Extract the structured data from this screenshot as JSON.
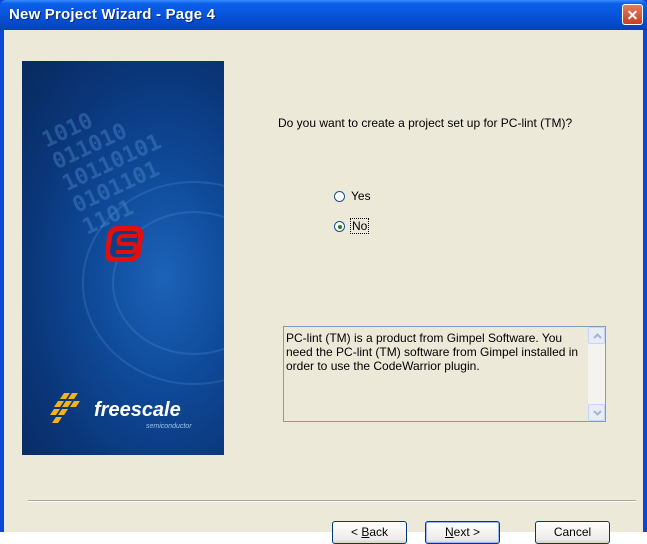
{
  "window": {
    "title": "New Project Wizard - Page  4"
  },
  "side_panel": {
    "brand_name": "freescale",
    "brand_sub": "semiconductor",
    "binary_text": "1010\n011010\n10110101\n0101101\n1101"
  },
  "question": {
    "text": "Do you want to create a project set up for PC-lint (TM)?"
  },
  "options": [
    {
      "label": "Yes",
      "selected": false
    },
    {
      "label": "No",
      "selected": true
    }
  ],
  "info": {
    "text": "PC-lint (TM) is a product from Gimpel Software. You need the PC-lint (TM) software from Gimpel installed in order to use the CodeWarrior plugin."
  },
  "buttons": {
    "back": {
      "prefix": "< ",
      "mnemonic": "B",
      "rest": "ack"
    },
    "next": {
      "mnemonic": "N",
      "rest": "ext >"
    },
    "cancel": {
      "label": "Cancel"
    }
  }
}
